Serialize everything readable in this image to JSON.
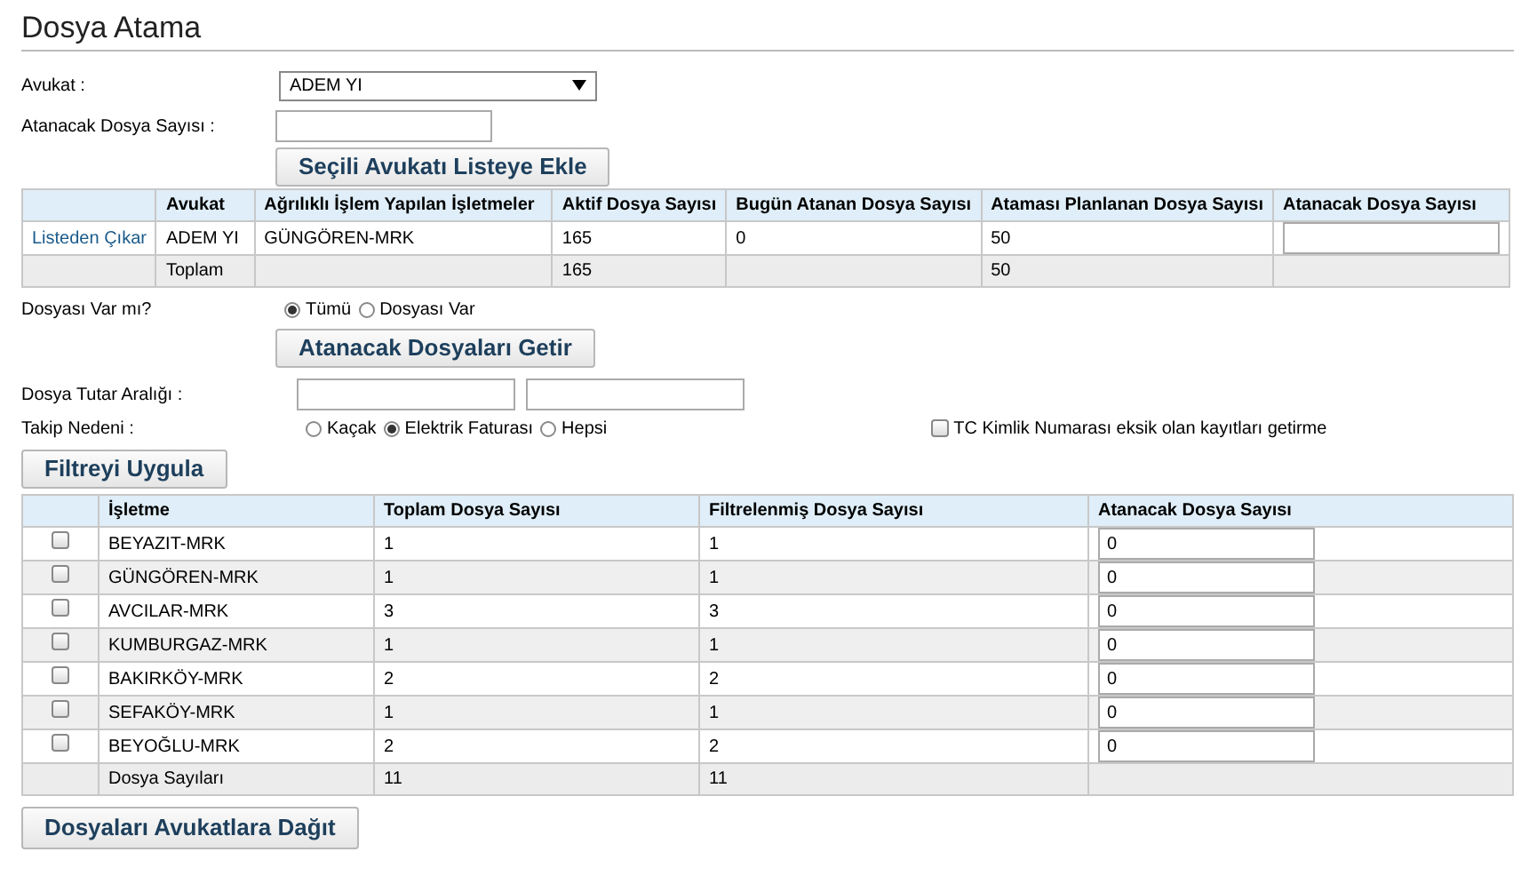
{
  "page_title": "Dosya Atama",
  "lawyer_field": {
    "label": "Avukat :",
    "value": "ADEM YI"
  },
  "count_field": {
    "label": "Atanacak Dosya Sayısı :"
  },
  "add_button": "Seçili Avukatı Listeye Ekle",
  "lawyer_table": {
    "columns": [
      "",
      "Avukat",
      "Ağrılıklı İşlem Yapılan İşletmeler",
      "Aktif Dosya Sayısı",
      "Bugün Atanan Dosya Sayısı",
      "Ataması Planlanan Dosya Sayısı",
      "Atanacak Dosya Sayısı"
    ],
    "rows": [
      {
        "link": "Listeden Çıkar",
        "lawyer": "ADEM YI",
        "businesses": "GÜNGÖREN-MRK",
        "active": "165",
        "today": "0",
        "planned": "50"
      }
    ],
    "total": {
      "label": "Toplam",
      "active": "165",
      "planned": "50"
    }
  },
  "has_file": {
    "label": "Dosyası Var mı?",
    "options": [
      {
        "label": "Tümü",
        "selected": true
      },
      {
        "label": "Dosyası Var",
        "selected": false
      }
    ]
  },
  "fetch_button": "Atanacak Dosyaları Getir",
  "amount_range": {
    "label": "Dosya Tutar Aralığı :"
  },
  "reason": {
    "label": "Takip Nedeni :",
    "options": [
      {
        "label": "Kaçak",
        "selected": false
      },
      {
        "label": "Elektrik Faturası",
        "selected": true
      },
      {
        "label": "Hepsi",
        "selected": false
      }
    ]
  },
  "tc_filter": {
    "label": "TC Kimlik Numarası eksik olan kayıtları getirme",
    "checked": false
  },
  "filter_button": "Filtreyi Uygula",
  "business_table": {
    "columns": [
      "",
      "İşletme",
      "Toplam Dosya Sayısı",
      "Filtrelenmiş Dosya Sayısı",
      "Atanacak Dosya Sayısı"
    ],
    "rows": [
      {
        "checked": false,
        "name": "BEYAZIT-MRK",
        "total": "1",
        "filtered": "1",
        "assign": "0"
      },
      {
        "checked": false,
        "name": "GÜNGÖREN-MRK",
        "total": "1",
        "filtered": "1",
        "assign": "0"
      },
      {
        "checked": false,
        "name": "AVCILAR-MRK",
        "total": "3",
        "filtered": "3",
        "assign": "0"
      },
      {
        "checked": false,
        "name": "KUMBURGAZ-MRK",
        "total": "1",
        "filtered": "1",
        "assign": "0"
      },
      {
        "checked": false,
        "name": "BAKIRKÖY-MRK",
        "total": "2",
        "filtered": "2",
        "assign": "0"
      },
      {
        "checked": false,
        "name": "SEFAKÖY-MRK",
        "total": "1",
        "filtered": "1",
        "assign": "0"
      },
      {
        "checked": false,
        "name": "BEYOĞLU-MRK",
        "total": "2",
        "filtered": "2",
        "assign": "0"
      }
    ],
    "total": {
      "label": "Dosya Sayıları",
      "total": "11",
      "filtered": "11"
    }
  },
  "distribute_button": "Dosyaları Avukatlara Dağıt"
}
